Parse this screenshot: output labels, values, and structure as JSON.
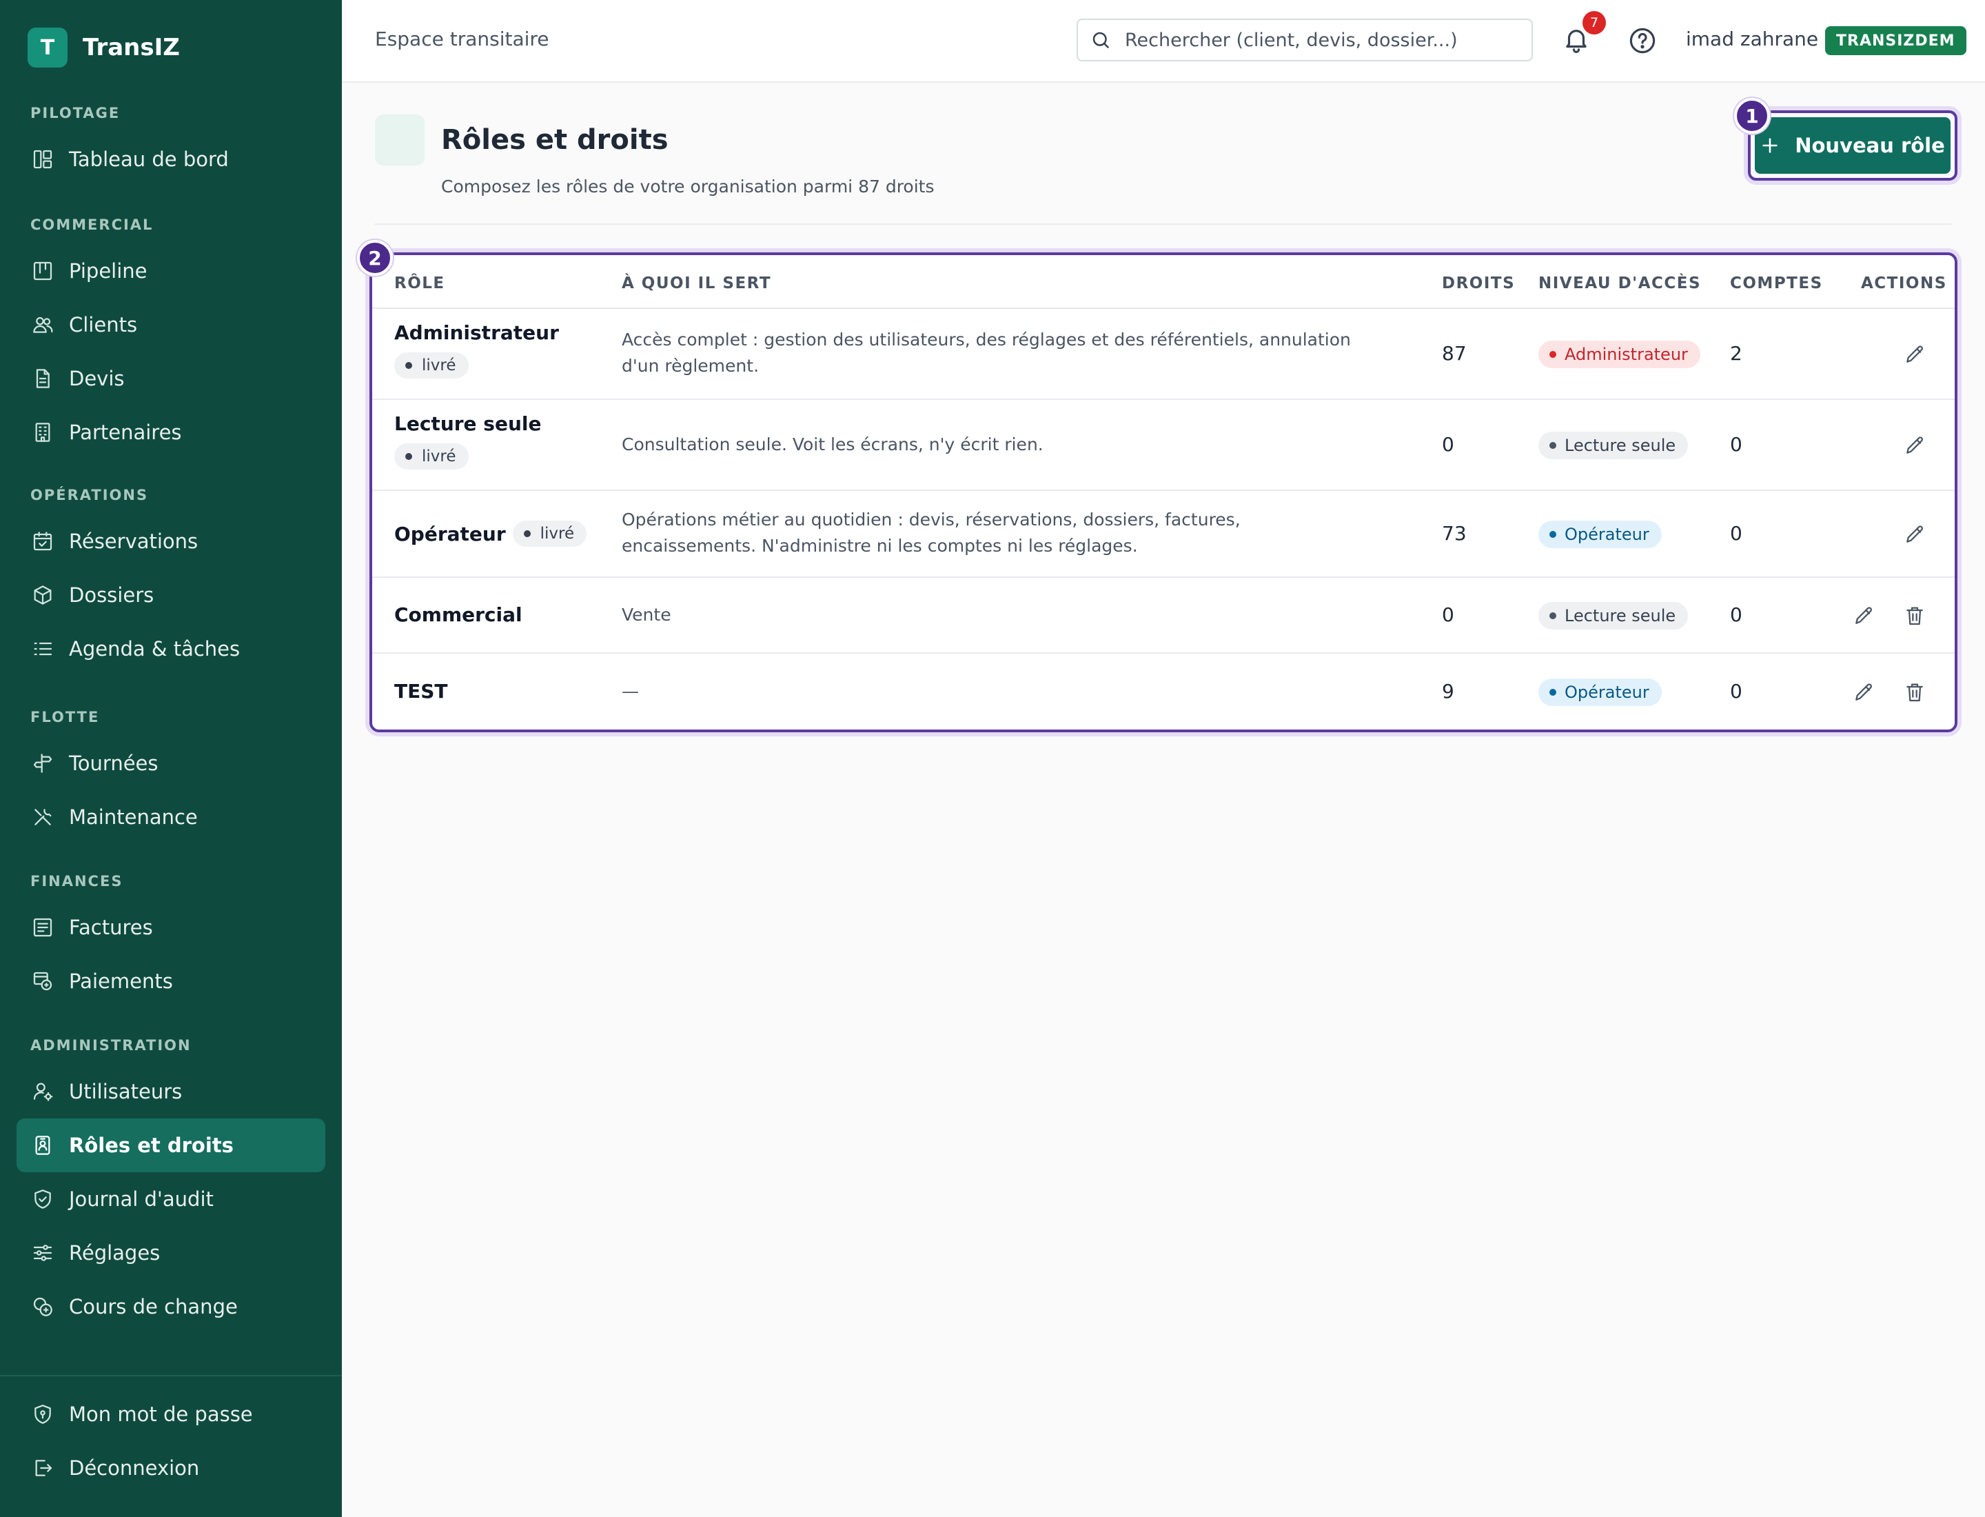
{
  "brand": {
    "logo_letter": "T",
    "name": "TransIZ"
  },
  "sidebar": {
    "sections": [
      {
        "title": "PILOTAGE",
        "items": [
          {
            "label": "Tableau de bord",
            "icon": "dashboard-icon"
          }
        ]
      },
      {
        "title": "COMMERCIAL",
        "items": [
          {
            "label": "Pipeline",
            "icon": "kanban-icon"
          },
          {
            "label": "Clients",
            "icon": "users-icon"
          },
          {
            "label": "Devis",
            "icon": "document-icon"
          },
          {
            "label": "Partenaires",
            "icon": "building-icon"
          }
        ]
      },
      {
        "title": "OPÉRATIONS",
        "items": [
          {
            "label": "Réservations",
            "icon": "calendar-check-icon"
          },
          {
            "label": "Dossiers",
            "icon": "box-icon"
          },
          {
            "label": "Agenda & tâches",
            "icon": "list-check-icon"
          }
        ]
      },
      {
        "title": "FLOTTE",
        "items": [
          {
            "label": "Tournées",
            "icon": "signpost-icon"
          },
          {
            "label": "Maintenance",
            "icon": "tools-icon"
          }
        ]
      },
      {
        "title": "FINANCES",
        "items": [
          {
            "label": "Factures",
            "icon": "invoice-icon"
          },
          {
            "label": "Paiements",
            "icon": "payment-icon"
          }
        ]
      },
      {
        "title": "ADMINISTRATION",
        "items": [
          {
            "label": "Utilisateurs",
            "icon": "user-gear-icon"
          },
          {
            "label": "Rôles et droits",
            "icon": "id-badge-icon",
            "active": true
          },
          {
            "label": "Journal d'audit",
            "icon": "shield-check-icon"
          },
          {
            "label": "Réglages",
            "icon": "sliders-icon"
          },
          {
            "label": "Cours de change",
            "icon": "coins-icon"
          }
        ]
      }
    ],
    "footer": [
      {
        "label": "Mon mot de passe",
        "icon": "shield-key-icon"
      },
      {
        "label": "Déconnexion",
        "icon": "logout-icon"
      }
    ]
  },
  "topbar": {
    "title": "Espace transitaire",
    "search_placeholder": "Rechercher (client, devis, dossier...)",
    "notification_count": "7",
    "username": "imad zahrane",
    "org_badge": "TRANSIZDEM"
  },
  "page": {
    "title": "Rôles et droits",
    "subtitle": "Composez les rôles de votre organisation parmi 87 droits",
    "new_role_label": "Nouveau rôle",
    "markers": {
      "new_role": "1",
      "table": "2"
    }
  },
  "table": {
    "columns": [
      "RÔLE",
      "À QUOI IL SERT",
      "DROITS",
      "NIVEAU D'ACCÈS",
      "COMPTES",
      "ACTIONS"
    ],
    "rows": [
      {
        "role": "Administrateur",
        "tag": "livré",
        "description": "Accès complet : gestion des utilisateurs, des réglages et des référentiels, annulation d'un règlement.",
        "rights": "87",
        "level": "Administrateur",
        "level_kind": "admin",
        "accounts": "2",
        "deletable": false
      },
      {
        "role": "Lecture seule",
        "tag": "livré",
        "description": "Consultation seule. Voit les écrans, n'y écrit rien.",
        "rights": "0",
        "level": "Lecture seule",
        "level_kind": "read",
        "accounts": "0",
        "deletable": false
      },
      {
        "role": "Opérateur",
        "tag": "livré",
        "description": "Opérations métier au quotidien : devis, réservations, dossiers, factures, encaissements. N'administre ni les comptes ni les réglages.",
        "rights": "73",
        "level": "Opérateur",
        "level_kind": "op",
        "accounts": "0",
        "deletable": false
      },
      {
        "role": "Commercial",
        "tag": "",
        "description": "Vente",
        "rights": "0",
        "level": "Lecture seule",
        "level_kind": "read",
        "accounts": "0",
        "deletable": true
      },
      {
        "role": "TEST",
        "tag": "",
        "description": "—",
        "rights": "9",
        "level": "Opérateur",
        "level_kind": "op",
        "accounts": "0",
        "deletable": true
      }
    ]
  }
}
